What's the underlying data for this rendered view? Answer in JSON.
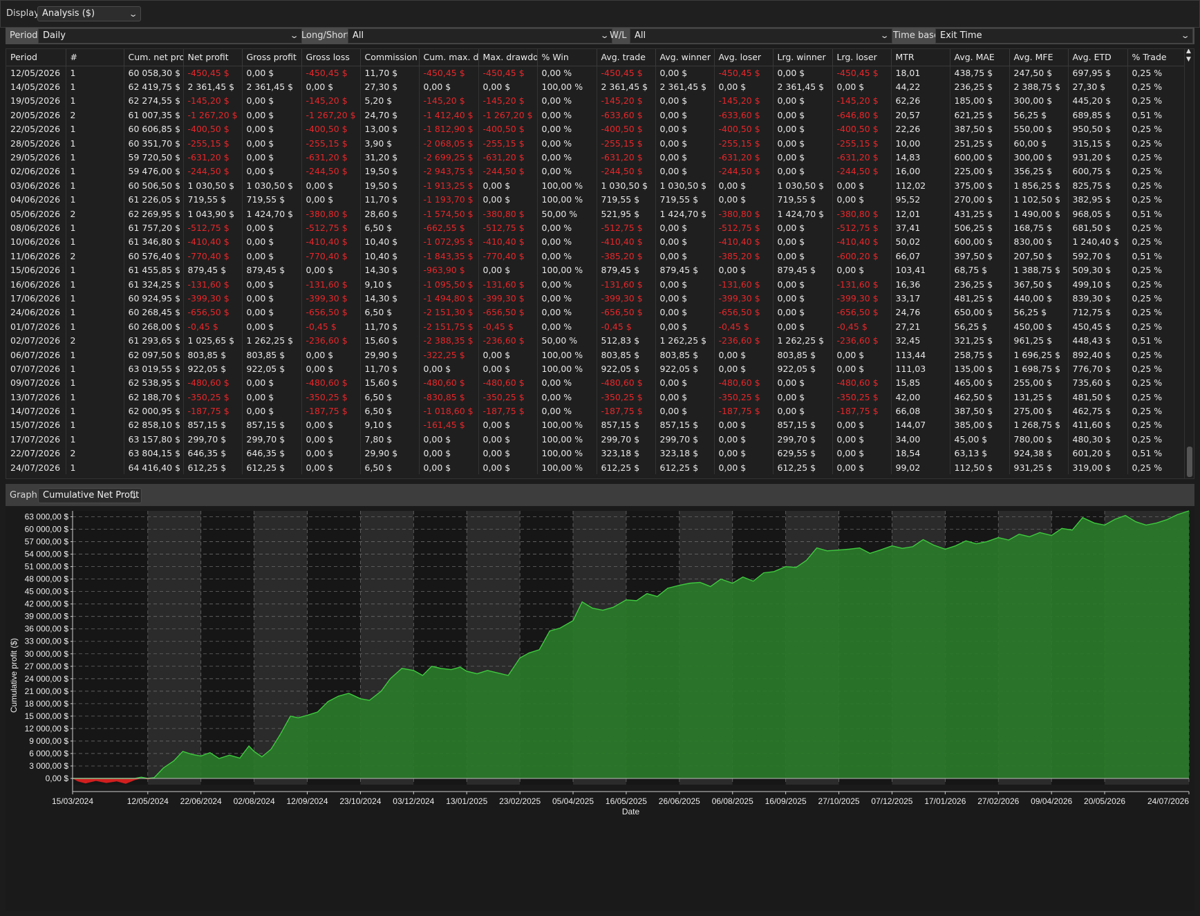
{
  "display": {
    "label": "Display",
    "value": "Analysis ($)"
  },
  "filters": {
    "period": {
      "label": "Period",
      "value": "Daily"
    },
    "long_short": {
      "label": "Long/Short",
      "value": "All"
    },
    "wl": {
      "label": "W/L",
      "value": "All"
    },
    "time_base": {
      "label": "Time base",
      "value": "Exit Time"
    }
  },
  "table": {
    "columns": [
      "Period",
      "#",
      "Cum. net prof",
      "Net profit",
      "Gross profit",
      "Gross loss",
      "Commission",
      "Cum. max. dra",
      "Max. drawdov",
      "% Win",
      "Avg. trade",
      "Avg. winner",
      "Avg. loser",
      "Lrg. winner",
      "Lrg. loser",
      "MTR",
      "Avg. MAE",
      "Avg. MFE",
      "Avg. ETD",
      "% Trade"
    ],
    "rows": [
      [
        "12/05/2026",
        "1",
        "60 058,30 $",
        "-450,45 $",
        "0,00 $",
        "-450,45 $",
        "11,70 $",
        "-450,45 $",
        "-450,45 $",
        "0,00 %",
        "-450,45 $",
        "0,00 $",
        "-450,45 $",
        "0,00 $",
        "-450,45 $",
        "18,01",
        "438,75 $",
        "247,50 $",
        "697,95 $",
        "0,25 %"
      ],
      [
        "14/05/2026",
        "1",
        "62 419,75 $",
        "2 361,45 $",
        "2 361,45 $",
        "0,00 $",
        "27,30 $",
        "0,00 $",
        "0,00 $",
        "100,00 %",
        "2 361,45 $",
        "2 361,45 $",
        "0,00 $",
        "2 361,45 $",
        "0,00 $",
        "44,22",
        "236,25 $",
        "2 388,75 $",
        "27,30 $",
        "0,25 %"
      ],
      [
        "19/05/2026",
        "1",
        "62 274,55 $",
        "-145,20 $",
        "0,00 $",
        "-145,20 $",
        "5,20 $",
        "-145,20 $",
        "-145,20 $",
        "0,00 %",
        "-145,20 $",
        "0,00 $",
        "-145,20 $",
        "0,00 $",
        "-145,20 $",
        "62,26",
        "185,00 $",
        "300,00 $",
        "445,20 $",
        "0,25 %"
      ],
      [
        "20/05/2026",
        "2",
        "61 007,35 $",
        "-1 267,20 $",
        "0,00 $",
        "-1 267,20 $",
        "24,70 $",
        "-1 412,40 $",
        "-1 267,20 $",
        "0,00 %",
        "-633,60 $",
        "0,00 $",
        "-633,60 $",
        "0,00 $",
        "-646,80 $",
        "20,57",
        "621,25 $",
        "56,25 $",
        "689,85 $",
        "0,51 %"
      ],
      [
        "22/05/2026",
        "1",
        "60 606,85 $",
        "-400,50 $",
        "0,00 $",
        "-400,50 $",
        "13,00 $",
        "-1 812,90 $",
        "-400,50 $",
        "0,00 %",
        "-400,50 $",
        "0,00 $",
        "-400,50 $",
        "0,00 $",
        "-400,50 $",
        "22,26",
        "387,50 $",
        "550,00 $",
        "950,50 $",
        "0,25 %"
      ],
      [
        "28/05/2026",
        "1",
        "60 351,70 $",
        "-255,15 $",
        "0,00 $",
        "-255,15 $",
        "3,90 $",
        "-2 068,05 $",
        "-255,15 $",
        "0,00 %",
        "-255,15 $",
        "0,00 $",
        "-255,15 $",
        "0,00 $",
        "-255,15 $",
        "10,00",
        "251,25 $",
        "60,00 $",
        "315,15 $",
        "0,25 %"
      ],
      [
        "29/05/2026",
        "1",
        "59 720,50 $",
        "-631,20 $",
        "0,00 $",
        "-631,20 $",
        "31,20 $",
        "-2 699,25 $",
        "-631,20 $",
        "0,00 %",
        "-631,20 $",
        "0,00 $",
        "-631,20 $",
        "0,00 $",
        "-631,20 $",
        "14,83",
        "600,00 $",
        "300,00 $",
        "931,20 $",
        "0,25 %"
      ],
      [
        "02/06/2026",
        "1",
        "59 476,00 $",
        "-244,50 $",
        "0,00 $",
        "-244,50 $",
        "19,50 $",
        "-2 943,75 $",
        "-244,50 $",
        "0,00 %",
        "-244,50 $",
        "0,00 $",
        "-244,50 $",
        "0,00 $",
        "-244,50 $",
        "16,00",
        "225,00 $",
        "356,25 $",
        "600,75 $",
        "0,25 %"
      ],
      [
        "03/06/2026",
        "1",
        "60 506,50 $",
        "1 030,50 $",
        "1 030,50 $",
        "0,00 $",
        "19,50 $",
        "-1 913,25 $",
        "0,00 $",
        "100,00 %",
        "1 030,50 $",
        "1 030,50 $",
        "0,00 $",
        "1 030,50 $",
        "0,00 $",
        "112,02",
        "375,00 $",
        "1 856,25 $",
        "825,75 $",
        "0,25 %"
      ],
      [
        "04/06/2026",
        "1",
        "61 226,05 $",
        "719,55 $",
        "719,55 $",
        "0,00 $",
        "11,70 $",
        "-1 193,70 $",
        "0,00 $",
        "100,00 %",
        "719,55 $",
        "719,55 $",
        "0,00 $",
        "719,55 $",
        "0,00 $",
        "95,52",
        "270,00 $",
        "1 102,50 $",
        "382,95 $",
        "0,25 %"
      ],
      [
        "05/06/2026",
        "2",
        "62 269,95 $",
        "1 043,90 $",
        "1 424,70 $",
        "-380,80 $",
        "28,60 $",
        "-1 574,50 $",
        "-380,80 $",
        "50,00 %",
        "521,95 $",
        "1 424,70 $",
        "-380,80 $",
        "1 424,70 $",
        "-380,80 $",
        "12,01",
        "431,25 $",
        "1 490,00 $",
        "968,05 $",
        "0,51 %"
      ],
      [
        "08/06/2026",
        "1",
        "61 757,20 $",
        "-512,75 $",
        "0,00 $",
        "-512,75 $",
        "6,50 $",
        "-662,55 $",
        "-512,75 $",
        "0,00 %",
        "-512,75 $",
        "0,00 $",
        "-512,75 $",
        "0,00 $",
        "-512,75 $",
        "37,41",
        "506,25 $",
        "168,75 $",
        "681,50 $",
        "0,25 %"
      ],
      [
        "10/06/2026",
        "1",
        "61 346,80 $",
        "-410,40 $",
        "0,00 $",
        "-410,40 $",
        "10,40 $",
        "-1 072,95 $",
        "-410,40 $",
        "0,00 %",
        "-410,40 $",
        "0,00 $",
        "-410,40 $",
        "0,00 $",
        "-410,40 $",
        "50,02",
        "600,00 $",
        "830,00 $",
        "1 240,40 $",
        "0,25 %"
      ],
      [
        "11/06/2026",
        "2",
        "60 576,40 $",
        "-770,40 $",
        "0,00 $",
        "-770,40 $",
        "10,40 $",
        "-1 843,35 $",
        "-770,40 $",
        "0,00 %",
        "-385,20 $",
        "0,00 $",
        "-385,20 $",
        "0,00 $",
        "-600,20 $",
        "66,07",
        "397,50 $",
        "207,50 $",
        "592,70 $",
        "0,51 %"
      ],
      [
        "15/06/2026",
        "1",
        "61 455,85 $",
        "879,45 $",
        "879,45 $",
        "0,00 $",
        "14,30 $",
        "-963,90 $",
        "0,00 $",
        "100,00 %",
        "879,45 $",
        "879,45 $",
        "0,00 $",
        "879,45 $",
        "0,00 $",
        "103,41",
        "68,75 $",
        "1 388,75 $",
        "509,30 $",
        "0,25 %"
      ],
      [
        "16/06/2026",
        "1",
        "61 324,25 $",
        "-131,60 $",
        "0,00 $",
        "-131,60 $",
        "9,10 $",
        "-1 095,50 $",
        "-131,60 $",
        "0,00 %",
        "-131,60 $",
        "0,00 $",
        "-131,60 $",
        "0,00 $",
        "-131,60 $",
        "16,36",
        "236,25 $",
        "367,50 $",
        "499,10 $",
        "0,25 %"
      ],
      [
        "17/06/2026",
        "1",
        "60 924,95 $",
        "-399,30 $",
        "0,00 $",
        "-399,30 $",
        "14,30 $",
        "-1 494,80 $",
        "-399,30 $",
        "0,00 %",
        "-399,30 $",
        "0,00 $",
        "-399,30 $",
        "0,00 $",
        "-399,30 $",
        "33,17",
        "481,25 $",
        "440,00 $",
        "839,30 $",
        "0,25 %"
      ],
      [
        "24/06/2026",
        "1",
        "60 268,45 $",
        "-656,50 $",
        "0,00 $",
        "-656,50 $",
        "6,50 $",
        "-2 151,30 $",
        "-656,50 $",
        "0,00 %",
        "-656,50 $",
        "0,00 $",
        "-656,50 $",
        "0,00 $",
        "-656,50 $",
        "24,76",
        "650,00 $",
        "56,25 $",
        "712,75 $",
        "0,25 %"
      ],
      [
        "01/07/2026",
        "1",
        "60 268,00 $",
        "-0,45 $",
        "0,00 $",
        "-0,45 $",
        "11,70 $",
        "-2 151,75 $",
        "-0,45 $",
        "0,00 %",
        "-0,45 $",
        "0,00 $",
        "-0,45 $",
        "0,00 $",
        "-0,45 $",
        "27,21",
        "56,25 $",
        "450,00 $",
        "450,45 $",
        "0,25 %"
      ],
      [
        "02/07/2026",
        "2",
        "61 293,65 $",
        "1 025,65 $",
        "1 262,25 $",
        "-236,60 $",
        "15,60 $",
        "-2 388,35 $",
        "-236,60 $",
        "50,00 %",
        "512,83 $",
        "1 262,25 $",
        "-236,60 $",
        "1 262,25 $",
        "-236,60 $",
        "32,45",
        "321,25 $",
        "961,25 $",
        "448,43 $",
        "0,51 %"
      ],
      [
        "06/07/2026",
        "1",
        "62 097,50 $",
        "803,85 $",
        "803,85 $",
        "0,00 $",
        "29,90 $",
        "-322,25 $",
        "0,00 $",
        "100,00 %",
        "803,85 $",
        "803,85 $",
        "0,00 $",
        "803,85 $",
        "0,00 $",
        "113,44",
        "258,75 $",
        "1 696,25 $",
        "892,40 $",
        "0,25 %"
      ],
      [
        "07/07/2026",
        "1",
        "63 019,55 $",
        "922,05 $",
        "922,05 $",
        "0,00 $",
        "11,70 $",
        "0,00 $",
        "0,00 $",
        "100,00 %",
        "922,05 $",
        "922,05 $",
        "0,00 $",
        "922,05 $",
        "0,00 $",
        "111,03",
        "135,00 $",
        "1 698,75 $",
        "776,70 $",
        "0,25 %"
      ],
      [
        "09/07/2026",
        "1",
        "62 538,95 $",
        "-480,60 $",
        "0,00 $",
        "-480,60 $",
        "15,60 $",
        "-480,60 $",
        "-480,60 $",
        "0,00 %",
        "-480,60 $",
        "0,00 $",
        "-480,60 $",
        "0,00 $",
        "-480,60 $",
        "15,85",
        "465,00 $",
        "255,00 $",
        "735,60 $",
        "0,25 %"
      ],
      [
        "13/07/2026",
        "1",
        "62 188,70 $",
        "-350,25 $",
        "0,00 $",
        "-350,25 $",
        "6,50 $",
        "-830,85 $",
        "-350,25 $",
        "0,00 %",
        "-350,25 $",
        "0,00 $",
        "-350,25 $",
        "0,00 $",
        "-350,25 $",
        "42,00",
        "462,50 $",
        "131,25 $",
        "481,50 $",
        "0,25 %"
      ],
      [
        "14/07/2026",
        "1",
        "62 000,95 $",
        "-187,75 $",
        "0,00 $",
        "-187,75 $",
        "6,50 $",
        "-1 018,60 $",
        "-187,75 $",
        "0,00 %",
        "-187,75 $",
        "0,00 $",
        "-187,75 $",
        "0,00 $",
        "-187,75 $",
        "66,08",
        "387,50 $",
        "275,00 $",
        "462,75 $",
        "0,25 %"
      ],
      [
        "15/07/2026",
        "1",
        "62 858,10 $",
        "857,15 $",
        "857,15 $",
        "0,00 $",
        "9,10 $",
        "-161,45 $",
        "0,00 $",
        "100,00 %",
        "857,15 $",
        "857,15 $",
        "0,00 $",
        "857,15 $",
        "0,00 $",
        "144,07",
        "385,00 $",
        "1 268,75 $",
        "411,60 $",
        "0,25 %"
      ],
      [
        "17/07/2026",
        "1",
        "63 157,80 $",
        "299,70 $",
        "299,70 $",
        "0,00 $",
        "7,80 $",
        "0,00 $",
        "0,00 $",
        "100,00 %",
        "299,70 $",
        "299,70 $",
        "0,00 $",
        "299,70 $",
        "0,00 $",
        "34,00",
        "45,00 $",
        "780,00 $",
        "480,30 $",
        "0,25 %"
      ],
      [
        "22/07/2026",
        "2",
        "63 804,15 $",
        "646,35 $",
        "646,35 $",
        "0,00 $",
        "29,90 $",
        "0,00 $",
        "0,00 $",
        "100,00 %",
        "323,18 $",
        "323,18 $",
        "0,00 $",
        "629,55 $",
        "0,00 $",
        "18,54",
        "63,13 $",
        "924,38 $",
        "601,20 $",
        "0,51 %"
      ],
      [
        "24/07/2026",
        "1",
        "64 416,40 $",
        "612,25 $",
        "612,25 $",
        "0,00 $",
        "6,50 $",
        "0,00 $",
        "0,00 $",
        "100,00 %",
        "612,25 $",
        "612,25 $",
        "0,00 $",
        "612,25 $",
        "0,00 $",
        "99,02",
        "112,50 $",
        "931,25 $",
        "319,00 $",
        "0,25 %"
      ]
    ]
  },
  "graph": {
    "label": "Graph",
    "value": "Cumulative Net Profit"
  },
  "chart_data": {
    "type": "area",
    "title": "",
    "xlabel": "Date",
    "ylabel": "Cumulative profit ($)",
    "ylim": [
      -1500,
      64416.4
    ],
    "yticks": [
      "0,00 $",
      "3 000,00 $",
      "6 000,00 $",
      "9 000,00 $",
      "12 000,00 $",
      "15 000,00 $",
      "18 000,00 $",
      "21 000,00 $",
      "24 000,00 $",
      "27 000,00 $",
      "30 000,00 $",
      "33 000,00 $",
      "36 000,00 $",
      "39 000,00 $",
      "42 000,00 $",
      "45 000,00 $",
      "48 000,00 $",
      "51 000,00 $",
      "54 000,00 $",
      "57 000,00 $",
      "60 000,00 $",
      "63 000,00 $"
    ],
    "ytick_values": [
      0,
      3000,
      6000,
      9000,
      12000,
      15000,
      18000,
      21000,
      24000,
      27000,
      30000,
      33000,
      36000,
      39000,
      42000,
      45000,
      48000,
      51000,
      54000,
      57000,
      60000,
      63000
    ],
    "xticks": [
      "15/03/2024",
      "12/05/2024",
      "22/06/2024",
      "02/08/2024",
      "12/09/2024",
      "23/10/2024",
      "03/12/2024",
      "13/01/2025",
      "23/02/2025",
      "05/04/2025",
      "16/05/2025",
      "26/06/2025",
      "06/08/2025",
      "16/09/2025",
      "27/10/2025",
      "07/12/2025",
      "17/01/2026",
      "27/02/2026",
      "09/04/2026",
      "20/05/2026",
      "24/07/2026"
    ],
    "grid": true,
    "colors": {
      "positive_fill": "#2a7a2a",
      "positive_line": "#3ecb3e",
      "negative": "#d11f1f",
      "band_light": "#2b2b2b",
      "band_dark": "#161616"
    },
    "x": [
      "15/03/2024",
      "19/03/2024",
      "25/03/2024",
      "02/04/2024",
      "10/04/2024",
      "18/04/2024",
      "25/04/2024",
      "02/05/2024",
      "07/05/2024",
      "12/05/2024",
      "17/05/2024",
      "24/05/2024",
      "01/06/2024",
      "08/06/2024",
      "15/06/2024",
      "22/06/2024",
      "29/06/2024",
      "06/07/2024",
      "14/07/2024",
      "22/07/2024",
      "29/07/2024",
      "02/08/2024",
      "08/08/2024",
      "15/08/2024",
      "22/08/2024",
      "30/08/2024",
      "05/09/2024",
      "12/09/2024",
      "20/09/2024",
      "28/09/2024",
      "06/10/2024",
      "14/10/2024",
      "23/10/2024",
      "30/10/2024",
      "08/11/2024",
      "15/11/2024",
      "24/11/2024",
      "03/12/2024",
      "10/12/2024",
      "17/12/2024",
      "24/12/2024",
      "01/01/2025",
      "08/01/2025",
      "13/01/2025",
      "21/01/2025",
      "29/01/2025",
      "06/02/2025",
      "14/02/2025",
      "23/02/2025",
      "02/03/2025",
      "10/03/2025",
      "18/03/2025",
      "26/03/2025",
      "05/04/2025",
      "12/04/2025",
      "20/04/2025",
      "28/04/2025",
      "06/05/2025",
      "16/05/2025",
      "24/05/2025",
      "01/06/2025",
      "09/06/2025",
      "17/06/2025",
      "26/06/2025",
      "04/07/2025",
      "12/07/2025",
      "20/07/2025",
      "28/07/2025",
      "06/08/2025",
      "14/08/2025",
      "22/08/2025",
      "30/08/2025",
      "07/09/2025",
      "16/09/2025",
      "24/09/2025",
      "02/10/2025",
      "10/10/2025",
      "18/10/2025",
      "27/10/2025",
      "04/11/2025",
      "12/11/2025",
      "20/11/2025",
      "28/11/2025",
      "07/12/2025",
      "15/12/2025",
      "23/12/2025",
      "31/12/2025",
      "08/01/2026",
      "17/01/2026",
      "25/01/2026",
      "02/02/2026",
      "10/02/2026",
      "18/02/2026",
      "27/02/2026",
      "07/03/2026",
      "15/03/2026",
      "23/03/2026",
      "31/03/2026",
      "09/04/2026",
      "17/04/2026",
      "25/04/2026",
      "03/05/2026",
      "12/05/2026",
      "20/05/2026",
      "28/05/2026",
      "05/06/2026",
      "13/06/2026",
      "21/06/2026",
      "29/06/2026",
      "07/07/2026",
      "15/07/2026",
      "24/07/2026"
    ],
    "series": [
      {
        "values": [
          0,
          -700,
          -1200,
          -600,
          -1100,
          -700,
          -1300,
          -400,
          300,
          -200,
          200,
          2500,
          4200,
          6500,
          5800,
          5400,
          6200,
          4800,
          5600,
          4900,
          7800,
          6500,
          5200,
          7000,
          10500,
          15000,
          14600,
          15200,
          16000,
          18500,
          19800,
          20500,
          19200,
          18800,
          21000,
          24000,
          26500,
          26000,
          24800,
          27000,
          26500,
          26200,
          26800,
          25800,
          25200,
          26000,
          25400,
          24800,
          29000,
          30200,
          31000,
          35500,
          36200,
          38000,
          42500,
          41000,
          40500,
          41200,
          43000,
          42800,
          44500,
          43800,
          45800,
          46500,
          47000,
          47200,
          46200,
          48000,
          47000,
          48500,
          47500,
          49500,
          49800,
          51000,
          50800,
          52500,
          55500,
          54800,
          55000,
          55200,
          55500,
          54200,
          55000,
          56000,
          55400,
          55800,
          57500,
          56200,
          55200,
          56000,
          57200,
          56500,
          57000,
          58000,
          57400,
          58800,
          58200,
          59200,
          58500,
          60200,
          59800,
          62800,
          61500,
          61000,
          62400,
          63300,
          61800,
          61000,
          61500,
          62300,
          63500,
          64416.4
        ]
      }
    ]
  }
}
